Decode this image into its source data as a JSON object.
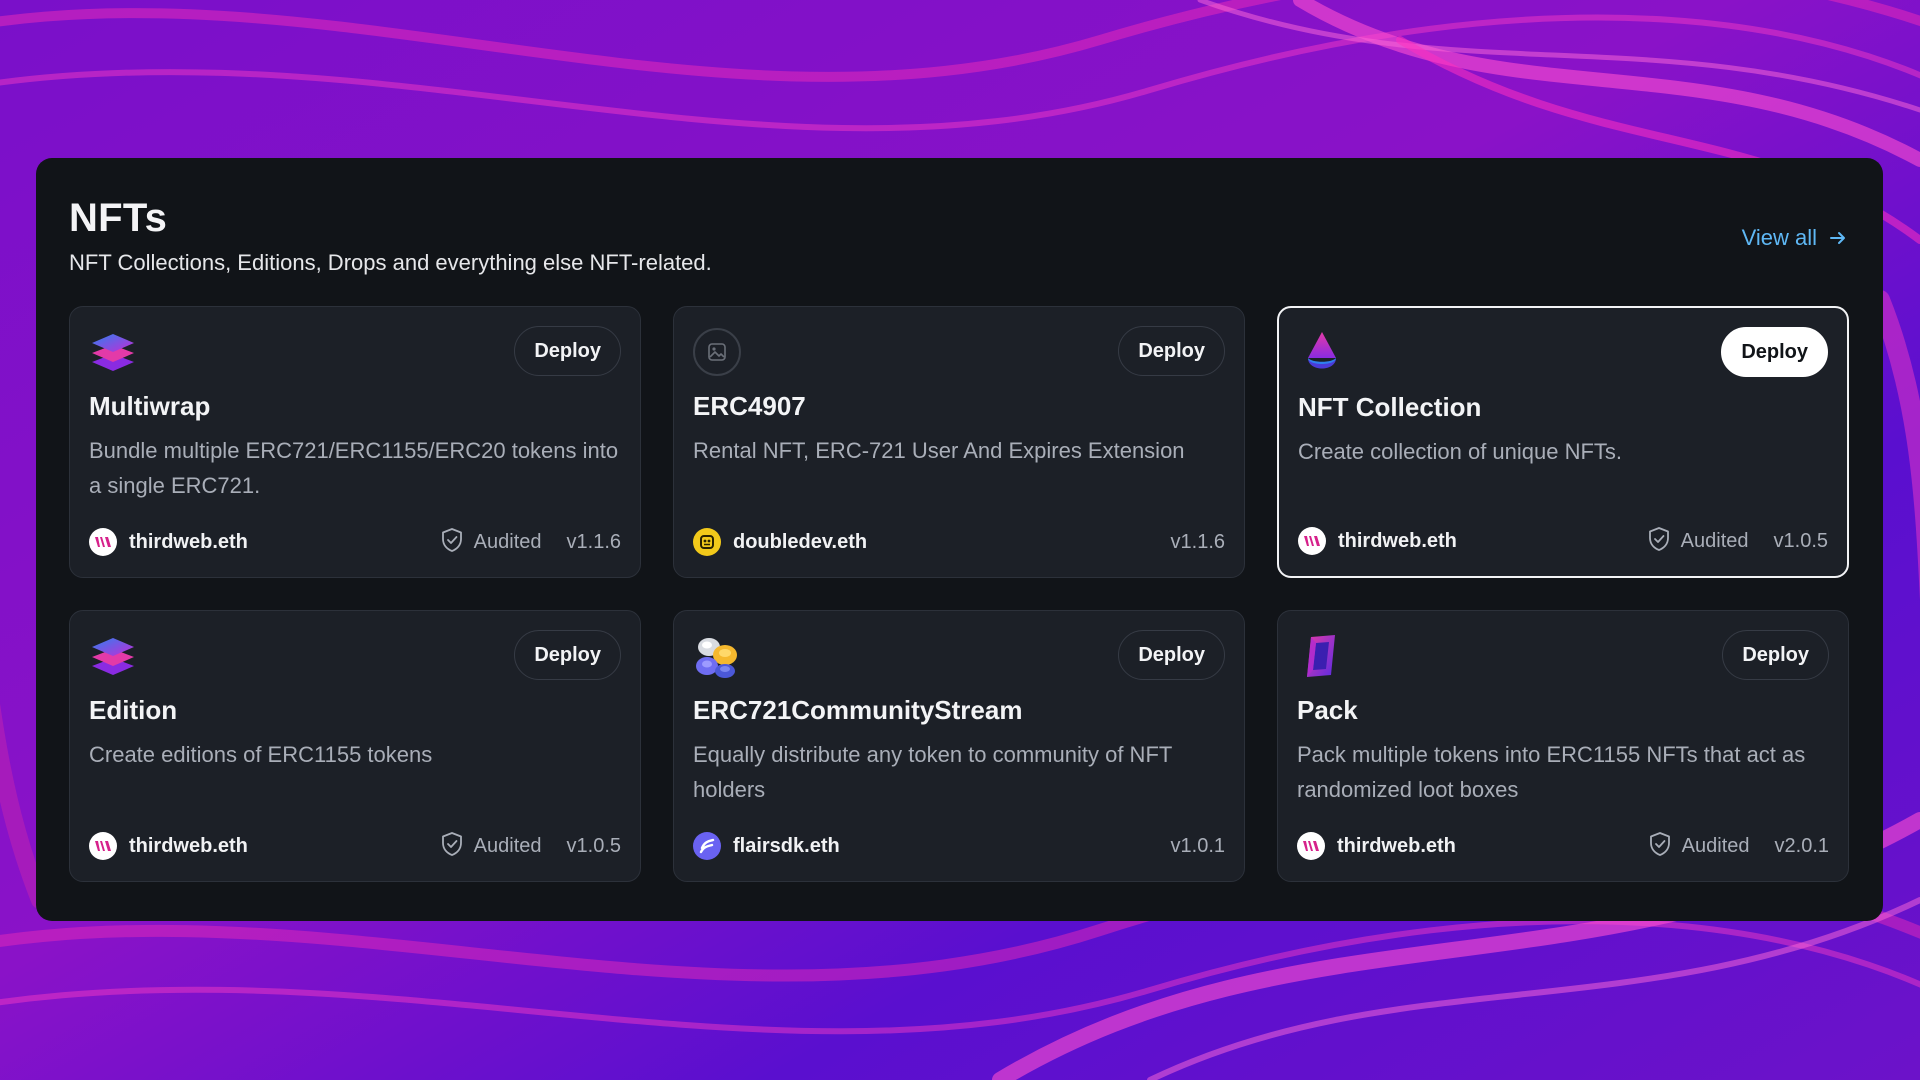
{
  "section": {
    "title": "NFTs",
    "subtitle": "NFT Collections, Editions, Drops and everything else NFT-related.",
    "view_all_label": "View all"
  },
  "colors": {
    "panel_bg": "#111418",
    "card_bg": "#1c2027",
    "link": "#5fb8f5",
    "thirdweb_brand": "#d6218b"
  },
  "cards": [
    {
      "name": "Multiwrap",
      "description": "Bundle multiple ERC721/ERC1155/ERC20 tokens into a single ERC721.",
      "icon": "stacked-layers-icon",
      "deploy_label": "Deploy",
      "author": "thirdweb.eth",
      "author_avatar": "thirdweb-logo-icon",
      "audited": true,
      "audited_label": "Audited",
      "version": "v1.1.6",
      "selected": false
    },
    {
      "name": "ERC4907",
      "description": "Rental NFT, ERC-721 User And Expires Extension",
      "icon": "image-placeholder-icon",
      "deploy_label": "Deploy",
      "author": "doubledev.eth",
      "author_avatar": "doubledev-avatar-icon",
      "audited": false,
      "version": "v1.1.6",
      "selected": false
    },
    {
      "name": "NFT Collection",
      "description": "Create collection of unique NFTs.",
      "icon": "droplet-cone-icon",
      "deploy_label": "Deploy",
      "author": "thirdweb.eth",
      "author_avatar": "thirdweb-logo-icon",
      "audited": true,
      "audited_label": "Audited",
      "version": "v1.0.5",
      "selected": true
    },
    {
      "name": "Edition",
      "description": "Create editions of ERC1155 tokens",
      "icon": "stacked-layers-icon",
      "deploy_label": "Deploy",
      "author": "thirdweb.eth",
      "author_avatar": "thirdweb-logo-icon",
      "audited": true,
      "audited_label": "Audited",
      "version": "v1.0.5",
      "selected": false
    },
    {
      "name": "ERC721CommunityStream",
      "description": "Equally distribute any token to community of NFT holders",
      "icon": "coins-cluster-icon",
      "deploy_label": "Deploy",
      "author": "flairsdk.eth",
      "author_avatar": "flair-logo-icon",
      "audited": false,
      "version": "v1.0.1",
      "selected": false
    },
    {
      "name": "Pack",
      "description": "Pack multiple tokens into ERC1155 NFTs that act as randomized loot boxes",
      "icon": "pack-box-icon",
      "deploy_label": "Deploy",
      "author": "thirdweb.eth",
      "author_avatar": "thirdweb-logo-icon",
      "audited": true,
      "audited_label": "Audited",
      "version": "v2.0.1",
      "selected": false
    }
  ]
}
